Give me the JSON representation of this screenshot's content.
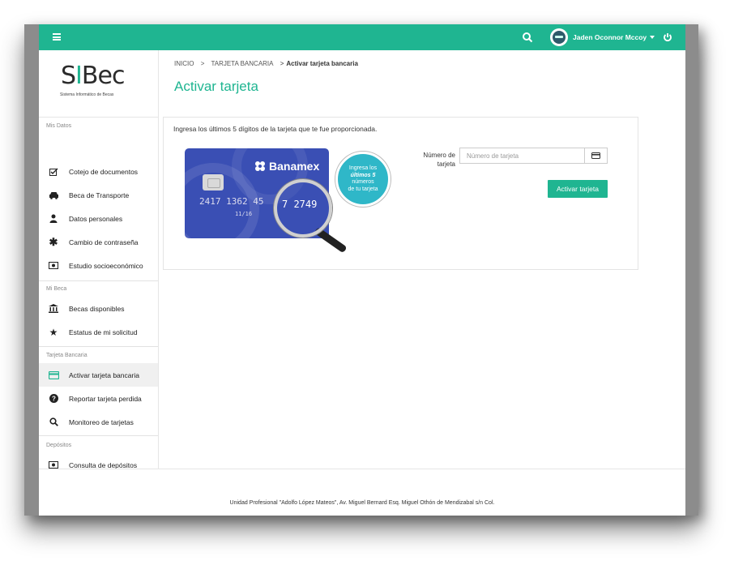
{
  "topbar": {
    "user_name": "Jaden Oconnor Mccoy"
  },
  "logo": {
    "text_prefix": "S",
    "text_mid": "I",
    "text_suffix": "Bec",
    "subtitle": "Sistema Informático de Becas"
  },
  "sidebar": {
    "sections": [
      {
        "title": "Mis Datos",
        "items": [
          {
            "label": "Cotejo de documentos",
            "icon": "checkbox-icon"
          },
          {
            "label": "Beca de Transporte",
            "icon": "car-icon"
          },
          {
            "label": "Datos personales",
            "icon": "user-icon"
          },
          {
            "label": "Cambio de contraseña",
            "icon": "asterisk-icon"
          },
          {
            "label": "Estudio socioeconómico",
            "icon": "money-icon"
          }
        ]
      },
      {
        "title": "Mi Beca",
        "items": [
          {
            "label": "Becas disponibles",
            "icon": "bank-icon"
          },
          {
            "label": "Estatus de mi solicitud",
            "icon": "star-icon"
          }
        ]
      },
      {
        "title": "Tarjeta Bancaria",
        "items": [
          {
            "label": "Activar tarjeta bancaria",
            "icon": "credit-card-icon",
            "active": true
          },
          {
            "label": "Reportar tarjeta perdida",
            "icon": "question-icon"
          },
          {
            "label": "Monitoreo de tarjetas",
            "icon": "search-icon"
          }
        ]
      },
      {
        "title": "Depósitos",
        "items": [
          {
            "label": "Consulta de depósitos",
            "icon": "money-icon"
          }
        ]
      }
    ]
  },
  "breadcrumb": {
    "items": [
      "INICIO",
      "TARJETA BANCARIA"
    ],
    "separator": ">",
    "current": "Activar tarjeta bancaria"
  },
  "page": {
    "title": "Activar tarjeta",
    "instruction": "Ingresa los últimos 5 dígitos de la tarjeta que te fue proporcionada."
  },
  "card_image": {
    "brand": "Banamex",
    "number_partial": "2417 1362 45",
    "expiry": "11/16",
    "magnified_digits": "7 2749",
    "bubble_line1": "Ingresa los",
    "bubble_line2": "últimos 5",
    "bubble_line3": "números",
    "bubble_line4": "de tu tarjeta"
  },
  "form": {
    "label": "Número de tarjeta",
    "placeholder": "Número de tarjeta",
    "value": "",
    "submit_label": "Activar tarjeta"
  },
  "footer": {
    "text": "Unidad Profesional \"Adolfo López Mateos\", Av. Miguel Bernard Esq. Miguel Othón de Mendizabal s/n Col."
  },
  "colors": {
    "accent": "#1fb591",
    "card_blue": "#3a4fb4",
    "bubble": "#2fb7c8"
  }
}
